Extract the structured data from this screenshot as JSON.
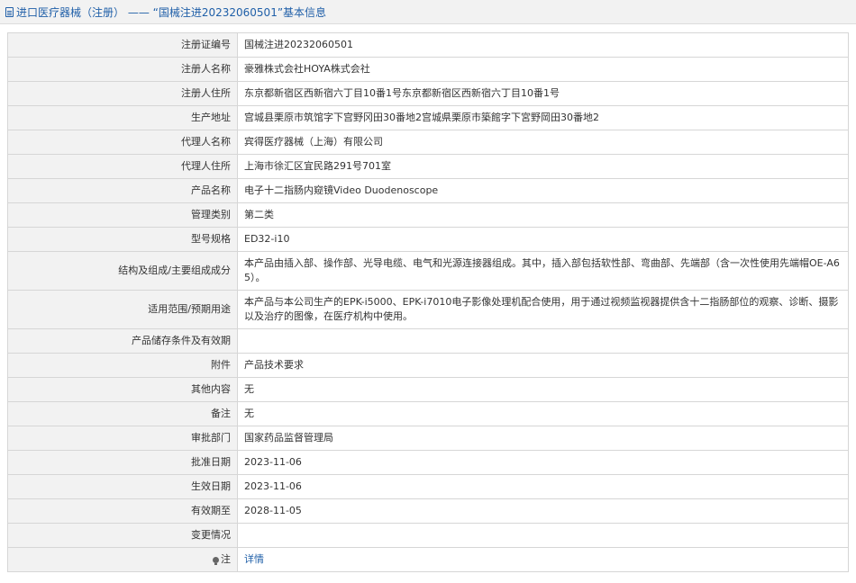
{
  "header": {
    "title": "进口医疗器械（注册） —— “国械注进20232060501”基本信息"
  },
  "rows": [
    {
      "label": "注册证编号",
      "value": "国械注进20232060501"
    },
    {
      "label": "注册人名称",
      "value": "豪雅株式会社HOYA株式会社"
    },
    {
      "label": "注册人住所",
      "value": "东京都新宿区西新宿六丁目10番1号东京都新宿区西新宿六丁目10番1号"
    },
    {
      "label": "生产地址",
      "value": "宫城县栗原市筑馆字下宫野冈田30番地2宫城県栗原市築館字下宮野岡田30番地2"
    },
    {
      "label": "代理人名称",
      "value": "宾得医疗器械（上海）有限公司"
    },
    {
      "label": "代理人住所",
      "value": "上海市徐汇区宜民路291号701室"
    },
    {
      "label": "产品名称",
      "value": "电子十二指肠内窥镜Video Duodenoscope"
    },
    {
      "label": "管理类别",
      "value": "第二类"
    },
    {
      "label": "型号规格",
      "value": "ED32-i10"
    },
    {
      "label": "结构及组成/主要组成成分",
      "value": "本产品由插入部、操作部、光导电缆、电气和光源连接器组成。其中，插入部包括软性部、弯曲部、先端部（含一次性使用先端帽OE-A65）。"
    },
    {
      "label": "适用范围/预期用途",
      "value": "本产品与本公司生产的EPK-i5000、EPK-i7010电子影像处理机配合使用，用于通过视频监视器提供含十二指肠部位的观察、诊断、摄影以及治疗的图像，在医疗机构中使用。"
    },
    {
      "label": "产品储存条件及有效期",
      "value": ""
    },
    {
      "label": "附件",
      "value": "产品技术要求"
    },
    {
      "label": "其他内容",
      "value": "无"
    },
    {
      "label": "备注",
      "value": "无"
    },
    {
      "label": "审批部门",
      "value": "国家药品监督管理局"
    },
    {
      "label": "批准日期",
      "value": "2023-11-06"
    },
    {
      "label": "生效日期",
      "value": "2023-11-06"
    },
    {
      "label": "有效期至",
      "value": "2028-11-05"
    },
    {
      "label": "变更情况",
      "value": ""
    }
  ],
  "note": {
    "label": "注",
    "link_text": "详情"
  }
}
